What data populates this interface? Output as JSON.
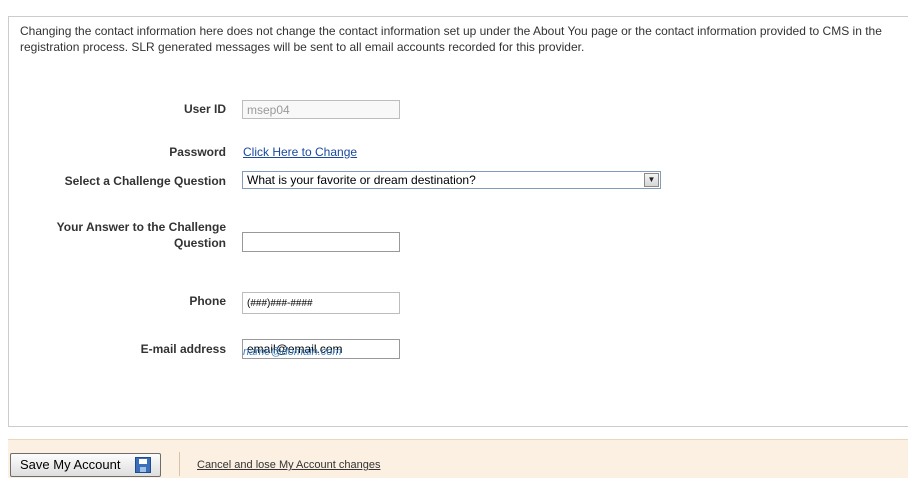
{
  "intro_text": "Changing the contact information here does not change the contact information set up under the About You page or the contact information provided to CMS in the registration process. SLR generated messages will be sent to all email accounts recorded for this provider.",
  "form": {
    "user_id_label": "User ID",
    "user_id_value": "msep04",
    "password_label": "Password",
    "password_link": "Click Here to Change",
    "challenge_label": "Select a Challenge Question",
    "challenge_selected": "What is your favorite or dream destination?",
    "answer_label": "Your Answer to the Challenge Question",
    "answer_value": "",
    "phone_label": "Phone",
    "phone_placeholder": "(###)###-####",
    "email_label": "E-mail address",
    "email_value": "email@email.com",
    "email_hint": "name@domain.com"
  },
  "footer": {
    "save_label": "Save My Account",
    "cancel_label": "Cancel and lose My Account changes"
  },
  "colors": {
    "link": "#1a4aa0",
    "hint": "#3a7fc1",
    "footer_bg": "#fbf0e1"
  }
}
